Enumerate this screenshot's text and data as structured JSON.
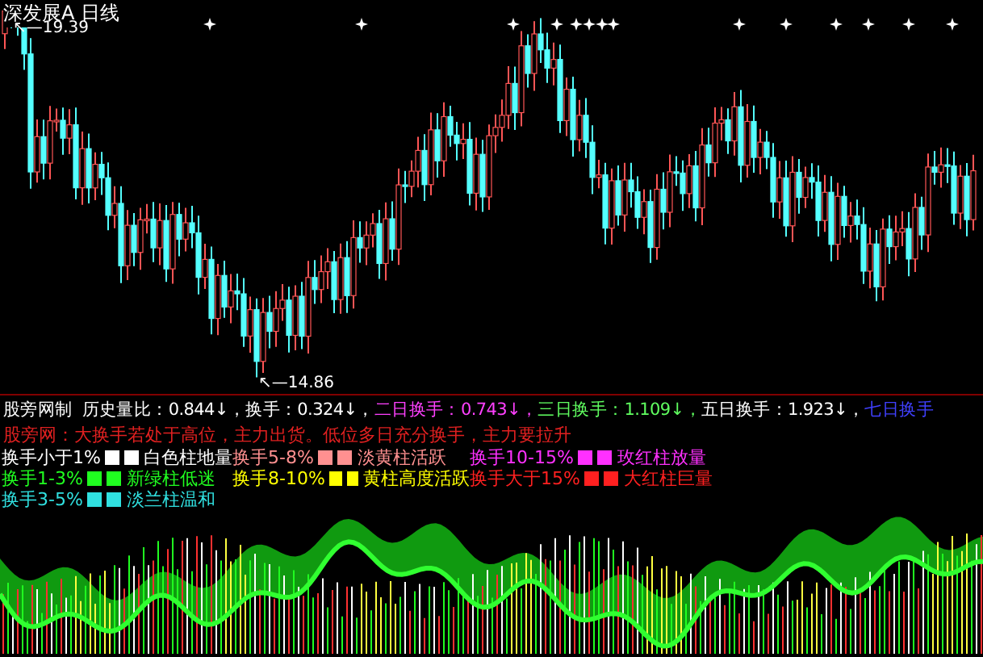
{
  "header": {
    "stock": "深发展A",
    "period": "日线"
  },
  "price_labels": {
    "high": "↖—19.39",
    "low": "↖—14.86"
  },
  "indicator": {
    "name": "股旁网制",
    "readings": [
      {
        "text": "历史量比：0.844↓，",
        "color": "#ffffff"
      },
      {
        "text": "换手：0.324↓，",
        "color": "#ffffff"
      },
      {
        "text": "二日换手：0.743↓，",
        "color": "#ff40ff"
      },
      {
        "text": "三日换手：1.109↓，",
        "color": "#60ff60"
      },
      {
        "text": "五日换手：1.923↓，",
        "color": "#ffffff"
      },
      {
        "text": "七日换手",
        "color": "#4040ff"
      }
    ]
  },
  "note": "股旁网：大换手若处于高位，主力出货。低位多日充分换手，主力要拉升",
  "legend": [
    {
      "label": "换手小于1%",
      "description": "白色柱地量",
      "color": "#ffffff"
    },
    {
      "label": "换手5-8%",
      "description": "淡黄柱活跃",
      "color": "#ff9090"
    },
    {
      "label": "换手10-15%",
      "description": "玫红柱放量",
      "color": "#ff30ff"
    },
    {
      "label": "换手1-3%",
      "description": "新绿柱低迷",
      "color": "#20ff20"
    },
    {
      "label": "换手8-10%",
      "description": "黄柱高度活跃",
      "color": "#ffff00"
    },
    {
      "label": "换手大于15%",
      "description": "大红柱巨量",
      "color": "#ff2020"
    },
    {
      "label": "换手3-5%",
      "description": "淡兰柱温和",
      "color": "#30e0e0"
    }
  ]
}
